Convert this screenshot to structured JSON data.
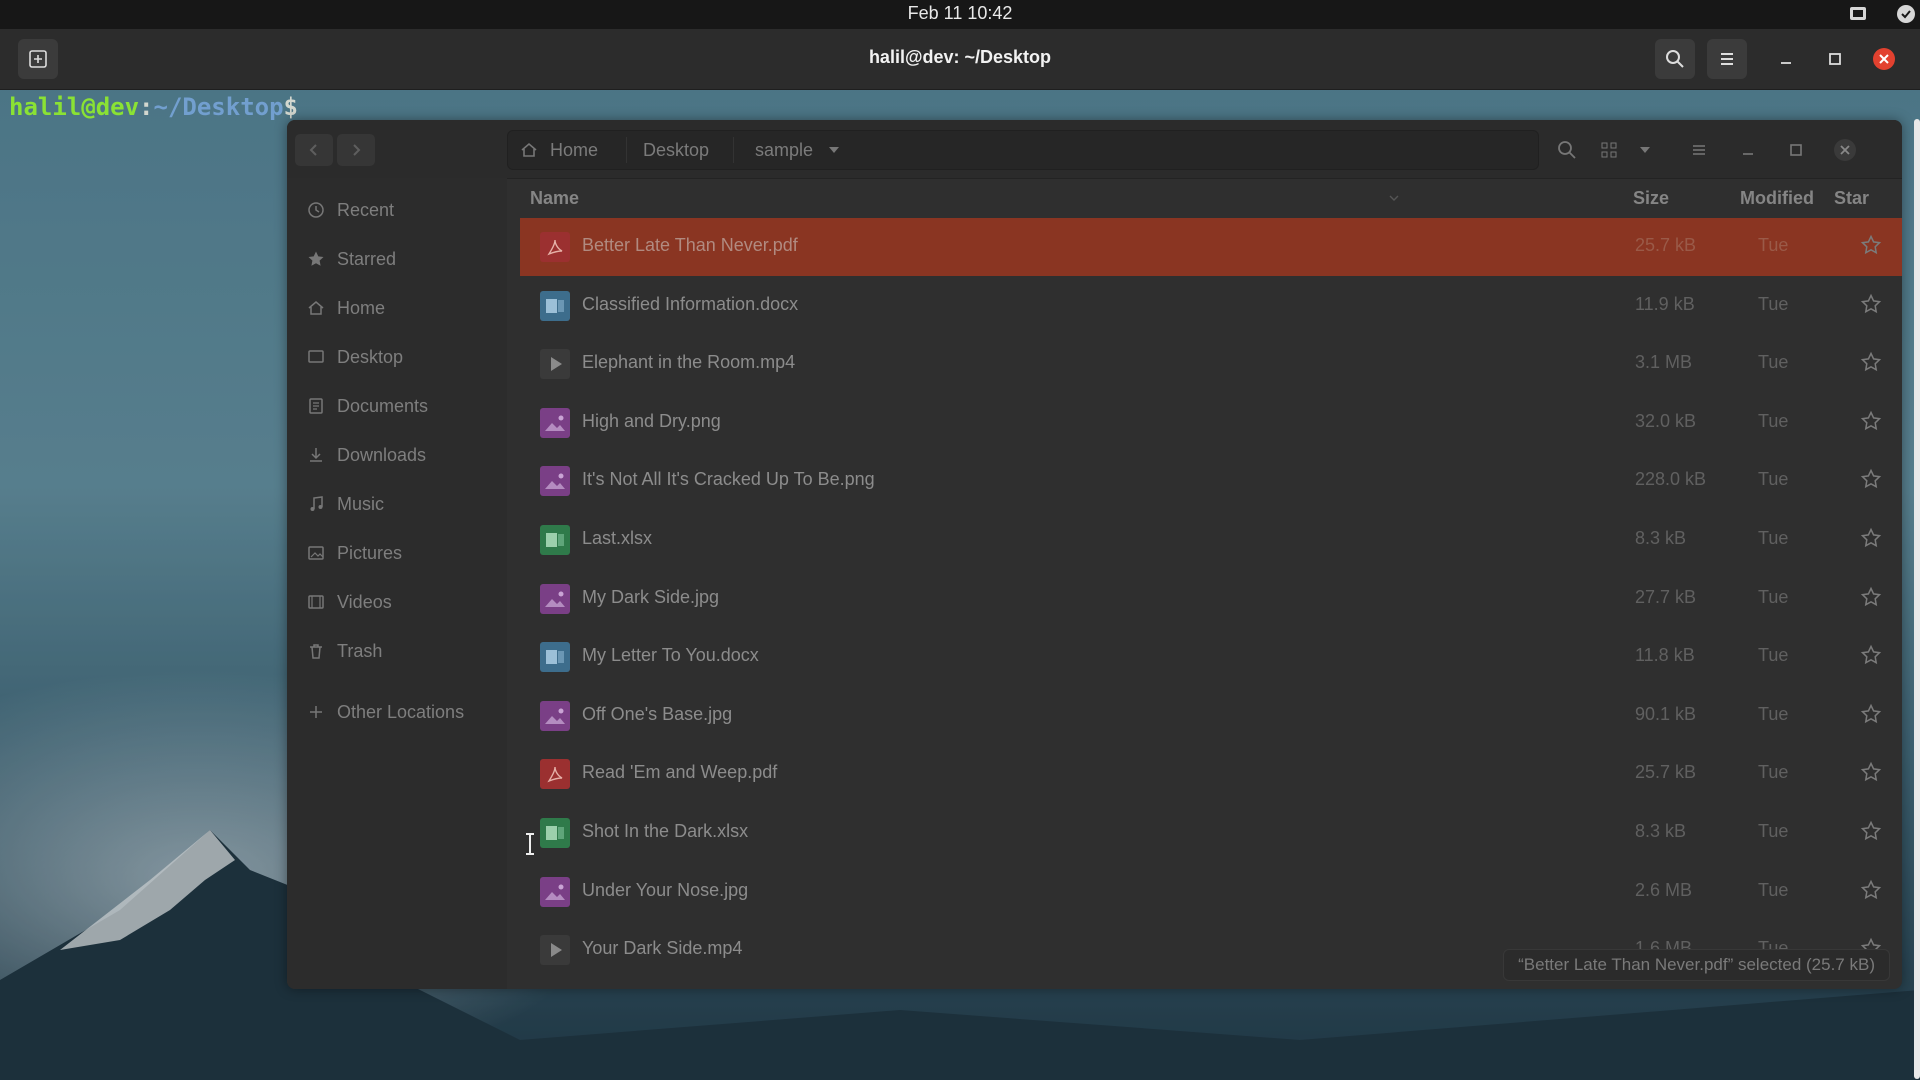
{
  "topbar": {
    "clock": "Feb 11  10:42"
  },
  "terminal": {
    "title": "halil@dev: ~/Desktop",
    "prompt": {
      "user": "halil@dev",
      "sep": ":",
      "path": "~/Desktop",
      "dollar": "$"
    }
  },
  "files": {
    "breadcrumbs": [
      "Home",
      "Desktop",
      "sample"
    ],
    "sidebar": [
      {
        "label": "Recent",
        "icon": "clock-icon"
      },
      {
        "label": "Starred",
        "icon": "star-icon"
      },
      {
        "label": "Home",
        "icon": "home-icon"
      },
      {
        "label": "Desktop",
        "icon": "desktop-icon"
      },
      {
        "label": "Documents",
        "icon": "document-icon"
      },
      {
        "label": "Downloads",
        "icon": "download-icon"
      },
      {
        "label": "Music",
        "icon": "music-icon"
      },
      {
        "label": "Pictures",
        "icon": "picture-icon"
      },
      {
        "label": "Videos",
        "icon": "video-icon"
      },
      {
        "label": "Trash",
        "icon": "trash-icon"
      },
      {
        "label": "Other Locations",
        "icon": "plus-icon"
      }
    ],
    "columns": {
      "name": "Name",
      "size": "Size",
      "modified": "Modified",
      "star": "Star"
    },
    "rows": [
      {
        "name": "Better Late Than Never.pdf",
        "size": "25.7 kB",
        "modified": "Tue",
        "type": "pdf",
        "selected": true
      },
      {
        "name": "Classified Information.docx",
        "size": "11.9 kB",
        "modified": "Tue",
        "type": "docx"
      },
      {
        "name": "Elephant in the Room.mp4",
        "size": "3.1 MB",
        "modified": "Tue",
        "type": "video"
      },
      {
        "name": "High and Dry.png",
        "size": "32.0 kB",
        "modified": "Tue",
        "type": "image"
      },
      {
        "name": "It's Not All It's Cracked Up To Be.png",
        "size": "228.0 kB",
        "modified": "Tue",
        "type": "image"
      },
      {
        "name": "Last.xlsx",
        "size": "8.3 kB",
        "modified": "Tue",
        "type": "xlsx"
      },
      {
        "name": "My Dark Side.jpg",
        "size": "27.7 kB",
        "modified": "Tue",
        "type": "image"
      },
      {
        "name": "My Letter To You.docx",
        "size": "11.8 kB",
        "modified": "Tue",
        "type": "docx"
      },
      {
        "name": "Off One's Base.jpg",
        "size": "90.1 kB",
        "modified": "Tue",
        "type": "image"
      },
      {
        "name": "Read 'Em and Weep.pdf",
        "size": "25.7 kB",
        "modified": "Tue",
        "type": "pdf"
      },
      {
        "name": "Shot In the Dark.xlsx",
        "size": "8.3 kB",
        "modified": "Tue",
        "type": "xlsx"
      },
      {
        "name": "Under Your Nose.jpg",
        "size": "2.6 MB",
        "modified": "Tue",
        "type": "image"
      },
      {
        "name": "Your Dark Side.mp4",
        "size": "1.6 MB",
        "modified": "Tue",
        "type": "video"
      }
    ],
    "status": "“Better Late Than Never.pdf” selected  (25.7 kB)"
  },
  "colors": {
    "selection": "#8a3522",
    "pdf": "#9b3030",
    "docx": "#3d6d8c",
    "xlsx": "#2f7a4a",
    "image": "#7a3f86",
    "video": "#3a3a3a"
  }
}
